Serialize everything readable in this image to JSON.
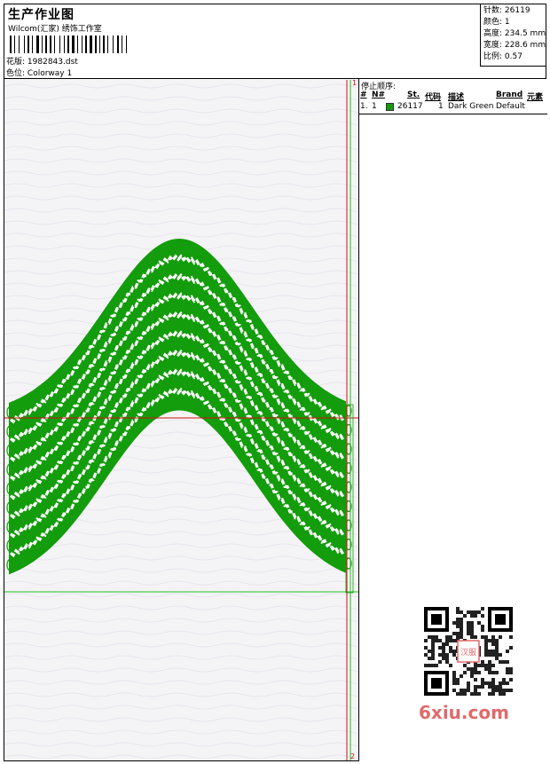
{
  "header": {
    "title": "生产作业图",
    "company": "Wilcom(汇家) 绣饰工作室",
    "design_label": "花版:",
    "design_value": "1982843.dst",
    "colorway_label": "色位:",
    "colorway_value": "Colorway 1"
  },
  "stats": [
    {
      "label": "针数:",
      "value": "26119"
    },
    {
      "label": "颜色:",
      "value": "1"
    },
    {
      "label": "高度:",
      "value": "234.5 mm"
    },
    {
      "label": "宽度:",
      "value": "228.6 mm"
    },
    {
      "label": "比例:",
      "value": "0.57"
    }
  ],
  "stop_sequence": {
    "title": "停止顺序:",
    "headers": {
      "num": "#",
      "n": "N#",
      "st": "St.",
      "code": "代码",
      "desc": "描述",
      "brand": "Brand",
      "element": "元素"
    },
    "rows": [
      {
        "num": "1.",
        "n": "1",
        "color": "#139c0b",
        "st": "26117",
        "code": "1",
        "desc": "Dark Green",
        "brand": "Default"
      }
    ]
  },
  "markers": {
    "top": "1",
    "bottom": "2"
  },
  "watermark": "6xiu.com",
  "qr_center_text": "汉服",
  "colors": {
    "thread": "#139c0b",
    "stop_line": "#d01010",
    "start_line": "#20c020"
  }
}
